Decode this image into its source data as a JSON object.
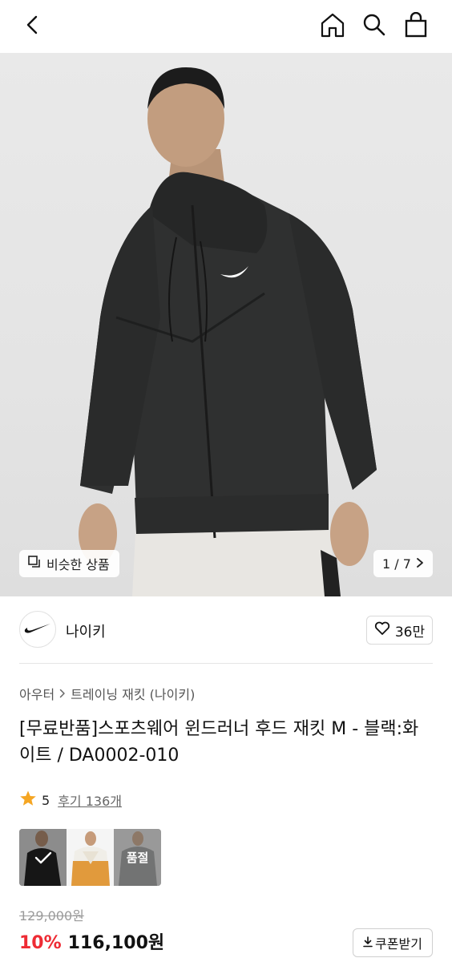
{
  "header": {
    "icons": [
      "back-chevron-icon",
      "home-icon",
      "search-icon",
      "shopping-bag-icon"
    ]
  },
  "gallery": {
    "similar_label": "비슷한 상품",
    "current": "1",
    "total": "7",
    "counter_text": "1 / 7"
  },
  "brand": {
    "name": "나이키",
    "likes": "36만"
  },
  "breadcrumb": {
    "category": "아우터",
    "subcategory": "트레이닝 재킷 (나이키)"
  },
  "product": {
    "title": "[무료반품]스포츠웨어 윈드러너 후드 재킷 M - 블랙:화이트 / DA0002-010"
  },
  "rating": {
    "score": "5",
    "reviews": "후기 136개"
  },
  "swatches": [
    {
      "name": "black",
      "selected": true,
      "sold_out": false
    },
    {
      "name": "white-orange",
      "selected": false,
      "sold_out": false
    },
    {
      "name": "grey",
      "selected": false,
      "sold_out": true,
      "label": "품절"
    }
  ],
  "price": {
    "original": "129,000원",
    "discount": "10%",
    "sale": "116,100원",
    "coupon_label": "쿠폰받기"
  },
  "colors": {
    "discount": "#ee2b34",
    "rating_star": "#f5a623"
  }
}
